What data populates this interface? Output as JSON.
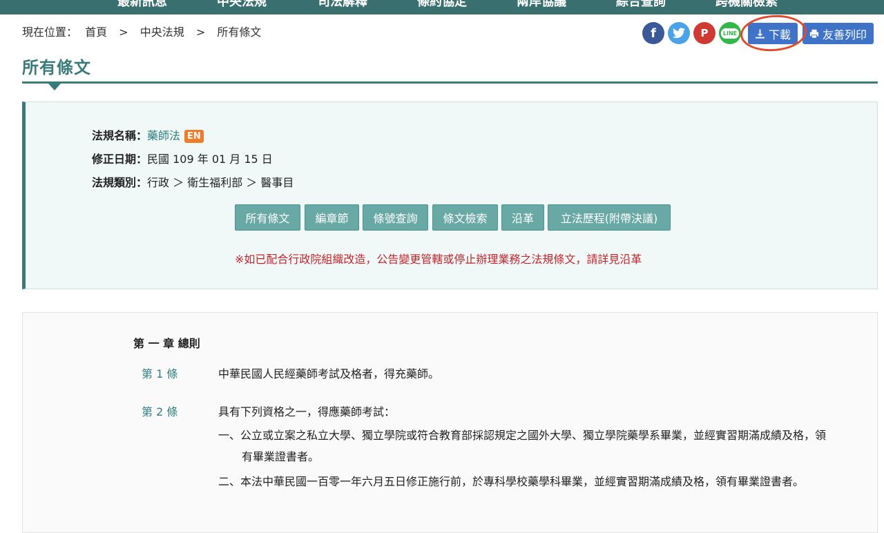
{
  "topnav": {
    "items": [
      "最新訊息",
      "中央法規",
      "司法解釋",
      "條約協定",
      "兩岸協議",
      "綜合查詢",
      "跨機關檢索"
    ]
  },
  "breadcrumb": {
    "prefix": "現在位置：",
    "items": [
      "首頁",
      "中央法規",
      "所有條文"
    ],
    "separator": ">"
  },
  "share": {
    "facebook": "f",
    "twitter_icon": "twitter-icon",
    "plurk": "P",
    "line": "LINE"
  },
  "toolbar": {
    "download_label": "下載",
    "print_label": "友善列印"
  },
  "page": {
    "title": "所有條文"
  },
  "law_info": {
    "name_label": "法規名稱：",
    "name_value": "藥師法",
    "en_badge": "EN",
    "date_label": "修正日期：",
    "date_value": "民國 109 年 01 月 15 日",
    "category_label": "法規類別：",
    "category_value": "行政 ＞ 衛生福利部 ＞ 醫事目"
  },
  "tabs": [
    "所有條文",
    "編章節",
    "條號查詢",
    "條文檢索",
    "沿革",
    "立法歷程(附帶決議)"
  ],
  "notice": "※如已配合行政院組織改造，公告變更管轄或停止辦理業務之法規條文，請詳見沿革",
  "content": {
    "chapter": "第 一 章 總則",
    "articles": [
      {
        "no": "第 1 條",
        "text": "中華民國人民經藥師考試及格者，得充藥師。"
      },
      {
        "no": "第 2 條",
        "text": "具有下列資格之一，得應藥師考試：",
        "items": [
          "一、公立或立案之私立大學、獨立學院或符合教育部採認規定之國外大學、獨立學院藥學系畢業，並經實習期滿成績及格，領有畢業證書者。",
          "二、本法中華民國一百零一年六月五日修正施行前，於專科學校藥學科畢業，並經實習期滿成績及格，領有畢業證書者。"
        ]
      }
    ]
  },
  "colors": {
    "primary": "#3a7a78",
    "button_blue": "#3f73c8",
    "notice_red": "#c0272d",
    "en_orange": "#ef7c2a",
    "annotation": "#e24a2c"
  }
}
